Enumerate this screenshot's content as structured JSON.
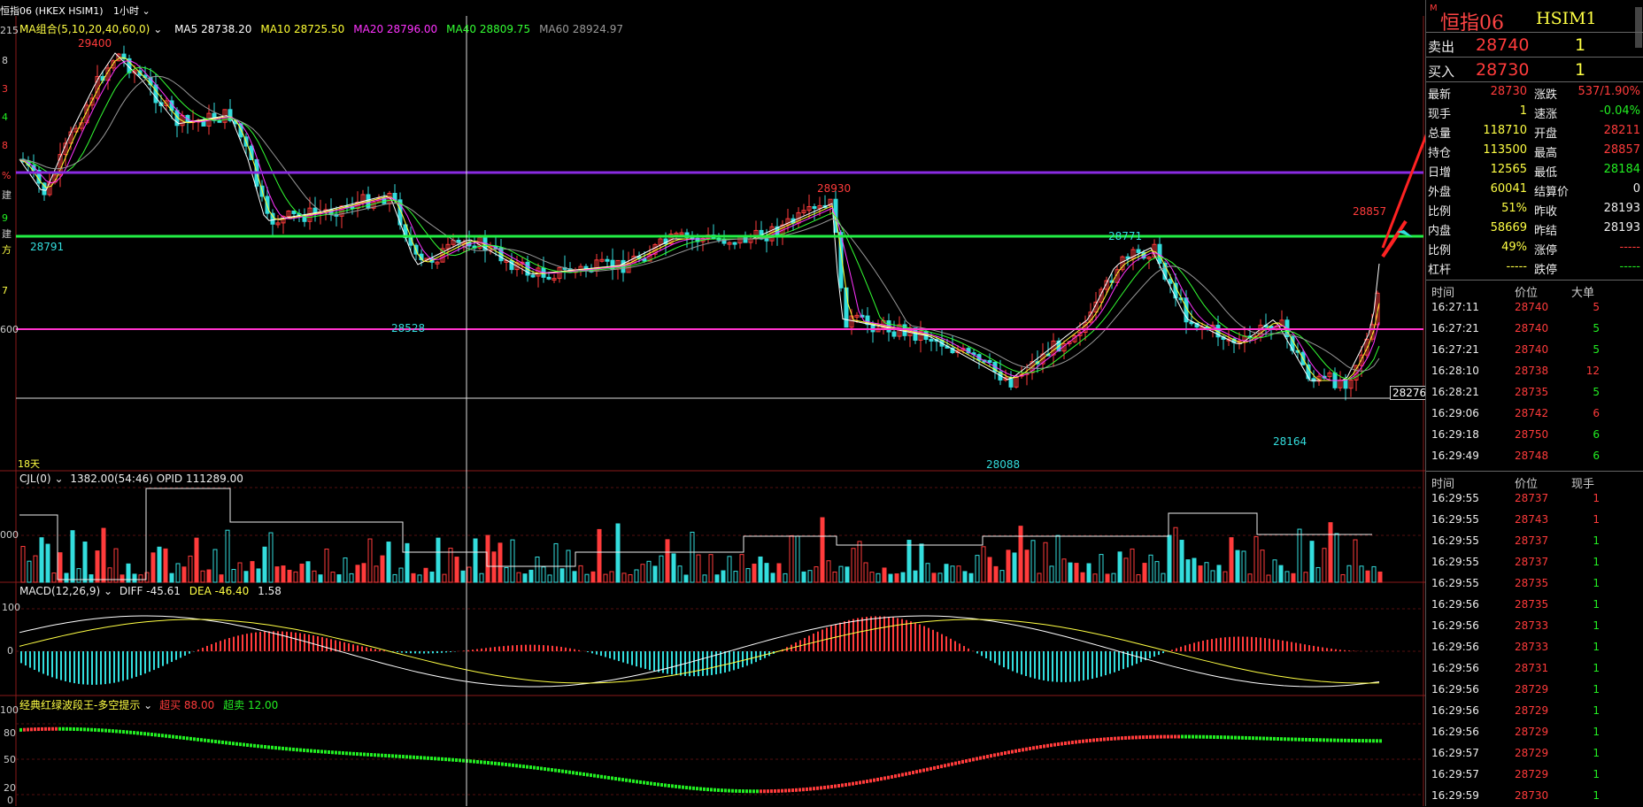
{
  "toolbar": {
    "symbol": "恒指06",
    "exchange": "(HKEX HSIM1)",
    "period": "1小时",
    "m_badge": "M"
  },
  "main": {
    "ma_title": "MA组合(5,10,20,40,60,0)",
    "ma_values": [
      {
        "label": "MA5 28738.20",
        "color": "#ffffff"
      },
      {
        "label": "MA10 28725.50",
        "color": "#ffff33"
      },
      {
        "label": "MA20 28796.00",
        "color": "#ff33ff"
      },
      {
        "label": "MA40 28809.75",
        "color": "#33ff33"
      },
      {
        "label": "MA60 28924.97",
        "color": "#999999"
      }
    ],
    "annotations": {
      "high_left": "29400",
      "low_left": "28791",
      "mid_high": "28930",
      "mid_low": "28528",
      "right_high": "28857",
      "peak2": "28771",
      "bottom_low": "28088",
      "right_low": "28164",
      "cursor_price": "28276",
      "days": "18天"
    },
    "left_axis_fragments": [
      "215",
      "8",
      "3",
      "4",
      "8",
      "%",
      "建",
      "9",
      "建",
      "方",
      "7",
      "600"
    ]
  },
  "volume": {
    "title": "CJL(0)",
    "values": "1382.00(54:46)  OPID 111289.00",
    "axis": [
      "000"
    ]
  },
  "macd": {
    "title": "MACD(12,26,9)",
    "diff": "DIFF -45.61",
    "dea": "DEA -46.40",
    "macd": "1.58",
    "axis": [
      "100",
      "0"
    ]
  },
  "osc": {
    "title": "经典红绿波段王-多空提示",
    "overbuy_label": "超买",
    "overbuy_value": "88.00",
    "oversell_label": "超卖",
    "oversell_value": "12.00",
    "axis": [
      "100",
      "80",
      "50",
      "20",
      "0"
    ]
  },
  "quote": {
    "name": "恒指06",
    "code": "HSIM1",
    "ask_label": "卖出",
    "ask_price": "28740",
    "ask_vol": "1",
    "bid_label": "买入",
    "bid_price": "28730",
    "bid_vol": "1",
    "stats": [
      {
        "l1": "最新",
        "v1": "28730",
        "c1": "#ff3b3b",
        "l2": "涨跌",
        "v2": "537/1.90%",
        "c2": "#ff3b3b"
      },
      {
        "l1": "现手",
        "v1": "1",
        "c1": "#ffff44",
        "l2": "速涨",
        "v2": "-0.04%",
        "c2": "#22ee22"
      },
      {
        "l1": "总量",
        "v1": "118710",
        "c1": "#ffff44",
        "l2": "开盘",
        "v2": "28211",
        "c2": "#ff3b3b"
      },
      {
        "l1": "持仓",
        "v1": "113500",
        "c1": "#ffff44",
        "l2": "最高",
        "v2": "28857",
        "c2": "#ff3b3b"
      },
      {
        "l1": "日增",
        "v1": "12565",
        "c1": "#ffff44",
        "l2": "最低",
        "v2": "28184",
        "c2": "#22ee22"
      },
      {
        "l1": "外盘",
        "v1": "60041",
        "c1": "#ffff44",
        "l2": "结算价",
        "v2": "0",
        "c2": "#eeeeee"
      },
      {
        "l1": "比例",
        "v1": "51%",
        "c1": "#ffff44",
        "l2": "昨收",
        "v2": "28193",
        "c2": "#eeeeee"
      },
      {
        "l1": "内盘",
        "v1": "58669",
        "c1": "#ffff44",
        "l2": "昨结",
        "v2": "28193",
        "c2": "#eeeeee"
      },
      {
        "l1": "比例",
        "v1": "49%",
        "c1": "#ffff44",
        "l2": "涨停",
        "v2": "-----",
        "c2": "#ff3b3b"
      },
      {
        "l1": "杠杆",
        "v1": "-----",
        "c1": "#ffff44",
        "l2": "跌停",
        "v2": "-----",
        "c2": "#22ee22"
      }
    ]
  },
  "big_trades": {
    "headers": [
      "时间",
      "价位",
      "大单"
    ],
    "rows": [
      {
        "time": "16:27:11",
        "price": "28740",
        "qty": "5",
        "qc": "#ff3b3b"
      },
      {
        "time": "16:27:21",
        "price": "28740",
        "qty": "5",
        "qc": "#22ee22"
      },
      {
        "time": "16:27:21",
        "price": "28740",
        "qty": "5",
        "qc": "#22ee22"
      },
      {
        "time": "16:28:10",
        "price": "28738",
        "qty": "12",
        "qc": "#ff3b3b"
      },
      {
        "time": "16:28:21",
        "price": "28735",
        "qty": "5",
        "qc": "#22ee22"
      },
      {
        "time": "16:29:06",
        "price": "28742",
        "qty": "6",
        "qc": "#ff3b3b"
      },
      {
        "time": "16:29:18",
        "price": "28750",
        "qty": "6",
        "qc": "#22ee22"
      },
      {
        "time": "16:29:49",
        "price": "28748",
        "qty": "6",
        "qc": "#22ee22"
      }
    ]
  },
  "ticks": {
    "headers": [
      "时间",
      "价位",
      "现手"
    ],
    "rows": [
      {
        "time": "16:29:55",
        "price": "28737",
        "qty": "1",
        "qc": "#ff3b3b"
      },
      {
        "time": "16:29:55",
        "price": "28743",
        "qty": "1",
        "qc": "#ff3b3b"
      },
      {
        "time": "16:29:55",
        "price": "28737",
        "qty": "1",
        "qc": "#22ee22"
      },
      {
        "time": "16:29:55",
        "price": "28737",
        "qty": "1",
        "qc": "#22ee22"
      },
      {
        "time": "16:29:55",
        "price": "28735",
        "qty": "1",
        "qc": "#22ee22"
      },
      {
        "time": "16:29:56",
        "price": "28735",
        "qty": "1",
        "qc": "#22ee22"
      },
      {
        "time": "16:29:56",
        "price": "28733",
        "qty": "1",
        "qc": "#22ee22"
      },
      {
        "time": "16:29:56",
        "price": "28733",
        "qty": "1",
        "qc": "#22ee22"
      },
      {
        "time": "16:29:56",
        "price": "28731",
        "qty": "1",
        "qc": "#22ee22"
      },
      {
        "time": "16:29:56",
        "price": "28729",
        "qty": "1",
        "qc": "#22ee22"
      },
      {
        "time": "16:29:56",
        "price": "28729",
        "qty": "1",
        "qc": "#22ee22"
      },
      {
        "time": "16:29:56",
        "price": "28729",
        "qty": "1",
        "qc": "#22ee22"
      },
      {
        "time": "16:29:57",
        "price": "28729",
        "qty": "1",
        "qc": "#22ee22"
      },
      {
        "time": "16:29:57",
        "price": "28729",
        "qty": "1",
        "qc": "#22ee22"
      },
      {
        "time": "16:29:59",
        "price": "28730",
        "qty": "1",
        "qc": "#22ee22"
      }
    ]
  },
  "colors": {
    "up": "#ff3b3b",
    "down": "#33dddd",
    "ma5": "#ffffff",
    "ma10": "#ffff33",
    "ma20": "#ff33ff",
    "ma40": "#33ff33",
    "ma60": "#999999"
  }
}
